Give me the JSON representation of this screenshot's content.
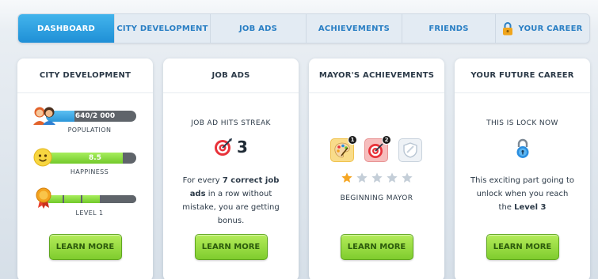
{
  "nav": {
    "tabs": [
      {
        "label": "Dashboard",
        "active": true
      },
      {
        "label": "City Development"
      },
      {
        "label": "Job Ads"
      },
      {
        "label": "Achievements"
      },
      {
        "label": "Friends"
      },
      {
        "label": "Your Career",
        "icon": "lock-icon"
      }
    ]
  },
  "cards": {
    "city": {
      "title": "City Development",
      "population": {
        "value_text": "640/2 000",
        "label": "Population",
        "progress": 0.32
      },
      "happiness": {
        "value_text": "8.5",
        "label": "Happiness",
        "progress": 0.85
      },
      "level": {
        "label": "Level 1",
        "segments_total": 5,
        "segments_filled": 3
      },
      "button": "Learn More"
    },
    "jobads": {
      "title": "Job Ads",
      "streak_label": "Job Ad Hits Streak",
      "streak_value": "3",
      "desc_pre": "For every ",
      "desc_bold": "7 correct job ads",
      "desc_post": " in a row without mistake, you are getting bonus.",
      "button": "Learn More"
    },
    "achievements": {
      "title": "Mayor's Achievements",
      "badges": [
        {
          "icon": "palette-icon",
          "count": "1"
        },
        {
          "icon": "target-icon",
          "count": "2"
        },
        {
          "icon": "shield-icon",
          "count": ""
        }
      ],
      "stars_filled": 1,
      "stars_total": 5,
      "rank": "Beginning Mayor",
      "button": "Learn More"
    },
    "career": {
      "title": "Your Future Career",
      "status": "This is lock now",
      "desc_pre": "This exciting part going to unlock when you reach the ",
      "desc_bold": "Level 3",
      "button": "Learn More"
    }
  },
  "colors": {
    "accent_blue": "#1f8fd6",
    "button_green": "#7fcc2e",
    "population_blue": "#3aa8e8",
    "happiness_green": "#8ee04a",
    "target_red": "#e8323a"
  }
}
